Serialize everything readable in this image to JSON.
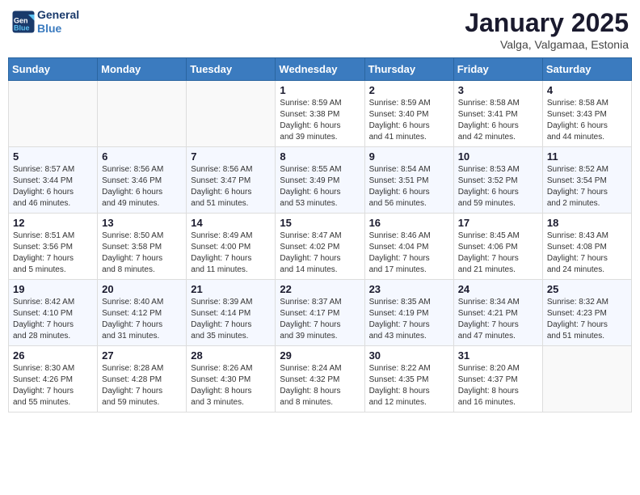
{
  "header": {
    "logo_line1": "General",
    "logo_line2": "Blue",
    "month": "January 2025",
    "location": "Valga, Valgamaa, Estonia"
  },
  "weekdays": [
    "Sunday",
    "Monday",
    "Tuesday",
    "Wednesday",
    "Thursday",
    "Friday",
    "Saturday"
  ],
  "weeks": [
    [
      {
        "num": "",
        "info": ""
      },
      {
        "num": "",
        "info": ""
      },
      {
        "num": "",
        "info": ""
      },
      {
        "num": "1",
        "info": "Sunrise: 8:59 AM\nSunset: 3:38 PM\nDaylight: 6 hours\nand 39 minutes."
      },
      {
        "num": "2",
        "info": "Sunrise: 8:59 AM\nSunset: 3:40 PM\nDaylight: 6 hours\nand 41 minutes."
      },
      {
        "num": "3",
        "info": "Sunrise: 8:58 AM\nSunset: 3:41 PM\nDaylight: 6 hours\nand 42 minutes."
      },
      {
        "num": "4",
        "info": "Sunrise: 8:58 AM\nSunset: 3:43 PM\nDaylight: 6 hours\nand 44 minutes."
      }
    ],
    [
      {
        "num": "5",
        "info": "Sunrise: 8:57 AM\nSunset: 3:44 PM\nDaylight: 6 hours\nand 46 minutes."
      },
      {
        "num": "6",
        "info": "Sunrise: 8:56 AM\nSunset: 3:46 PM\nDaylight: 6 hours\nand 49 minutes."
      },
      {
        "num": "7",
        "info": "Sunrise: 8:56 AM\nSunset: 3:47 PM\nDaylight: 6 hours\nand 51 minutes."
      },
      {
        "num": "8",
        "info": "Sunrise: 8:55 AM\nSunset: 3:49 PM\nDaylight: 6 hours\nand 53 minutes."
      },
      {
        "num": "9",
        "info": "Sunrise: 8:54 AM\nSunset: 3:51 PM\nDaylight: 6 hours\nand 56 minutes."
      },
      {
        "num": "10",
        "info": "Sunrise: 8:53 AM\nSunset: 3:52 PM\nDaylight: 6 hours\nand 59 minutes."
      },
      {
        "num": "11",
        "info": "Sunrise: 8:52 AM\nSunset: 3:54 PM\nDaylight: 7 hours\nand 2 minutes."
      }
    ],
    [
      {
        "num": "12",
        "info": "Sunrise: 8:51 AM\nSunset: 3:56 PM\nDaylight: 7 hours\nand 5 minutes."
      },
      {
        "num": "13",
        "info": "Sunrise: 8:50 AM\nSunset: 3:58 PM\nDaylight: 7 hours\nand 8 minutes."
      },
      {
        "num": "14",
        "info": "Sunrise: 8:49 AM\nSunset: 4:00 PM\nDaylight: 7 hours\nand 11 minutes."
      },
      {
        "num": "15",
        "info": "Sunrise: 8:47 AM\nSunset: 4:02 PM\nDaylight: 7 hours\nand 14 minutes."
      },
      {
        "num": "16",
        "info": "Sunrise: 8:46 AM\nSunset: 4:04 PM\nDaylight: 7 hours\nand 17 minutes."
      },
      {
        "num": "17",
        "info": "Sunrise: 8:45 AM\nSunset: 4:06 PM\nDaylight: 7 hours\nand 21 minutes."
      },
      {
        "num": "18",
        "info": "Sunrise: 8:43 AM\nSunset: 4:08 PM\nDaylight: 7 hours\nand 24 minutes."
      }
    ],
    [
      {
        "num": "19",
        "info": "Sunrise: 8:42 AM\nSunset: 4:10 PM\nDaylight: 7 hours\nand 28 minutes."
      },
      {
        "num": "20",
        "info": "Sunrise: 8:40 AM\nSunset: 4:12 PM\nDaylight: 7 hours\nand 31 minutes."
      },
      {
        "num": "21",
        "info": "Sunrise: 8:39 AM\nSunset: 4:14 PM\nDaylight: 7 hours\nand 35 minutes."
      },
      {
        "num": "22",
        "info": "Sunrise: 8:37 AM\nSunset: 4:17 PM\nDaylight: 7 hours\nand 39 minutes."
      },
      {
        "num": "23",
        "info": "Sunrise: 8:35 AM\nSunset: 4:19 PM\nDaylight: 7 hours\nand 43 minutes."
      },
      {
        "num": "24",
        "info": "Sunrise: 8:34 AM\nSunset: 4:21 PM\nDaylight: 7 hours\nand 47 minutes."
      },
      {
        "num": "25",
        "info": "Sunrise: 8:32 AM\nSunset: 4:23 PM\nDaylight: 7 hours\nand 51 minutes."
      }
    ],
    [
      {
        "num": "26",
        "info": "Sunrise: 8:30 AM\nSunset: 4:26 PM\nDaylight: 7 hours\nand 55 minutes."
      },
      {
        "num": "27",
        "info": "Sunrise: 8:28 AM\nSunset: 4:28 PM\nDaylight: 7 hours\nand 59 minutes."
      },
      {
        "num": "28",
        "info": "Sunrise: 8:26 AM\nSunset: 4:30 PM\nDaylight: 8 hours\nand 3 minutes."
      },
      {
        "num": "29",
        "info": "Sunrise: 8:24 AM\nSunset: 4:32 PM\nDaylight: 8 hours\nand 8 minutes."
      },
      {
        "num": "30",
        "info": "Sunrise: 8:22 AM\nSunset: 4:35 PM\nDaylight: 8 hours\nand 12 minutes."
      },
      {
        "num": "31",
        "info": "Sunrise: 8:20 AM\nSunset: 4:37 PM\nDaylight: 8 hours\nand 16 minutes."
      },
      {
        "num": "",
        "info": ""
      }
    ]
  ]
}
